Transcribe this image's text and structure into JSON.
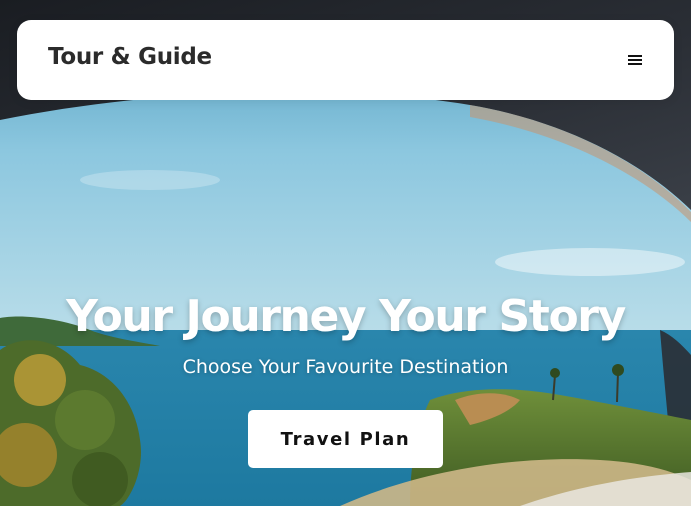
{
  "navbar": {
    "brand": "Tour & Guide",
    "menu_icon": "hamburger-menu-icon"
  },
  "hero": {
    "title": "Your Journey Your Story",
    "subtitle": "Choose Your Favourite Destination",
    "cta_label": "Travel Plan",
    "background": "photo through a car window of a blue sea, sky and tropical hillside vegetation"
  },
  "colors": {
    "navbar_bg": "#ffffff",
    "brand_text": "#2b2b2b",
    "hero_text": "#ffffff",
    "button_bg": "#ffffff",
    "button_text": "#111111",
    "sea": "#2f8fb5",
    "sky": "#7fc0da"
  }
}
